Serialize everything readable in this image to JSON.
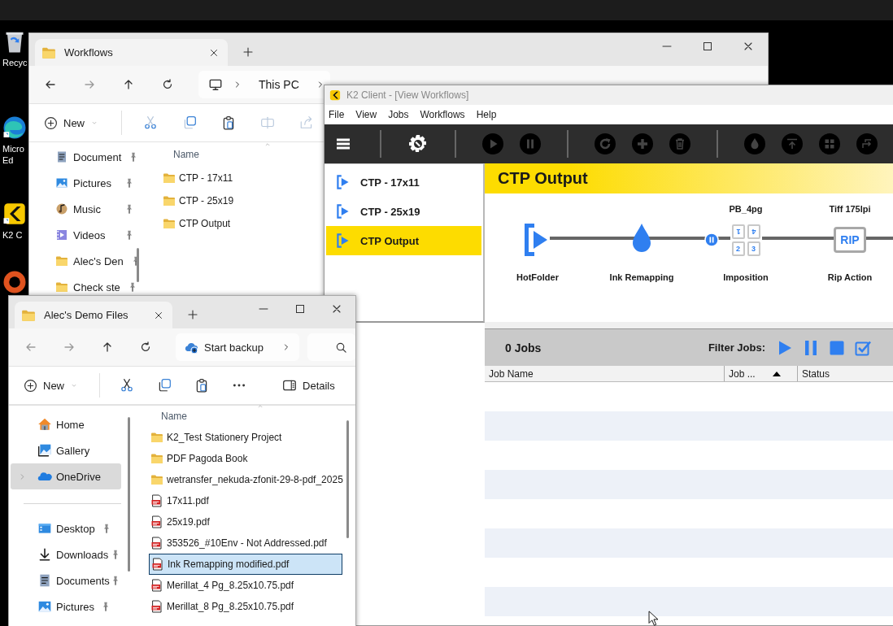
{
  "desktop": {
    "icons": [
      {
        "kind": "recycle",
        "label": "Recyc"
      },
      {
        "kind": "edge",
        "label": "Micro Ed"
      },
      {
        "kind": "k2",
        "label": "K2 C"
      },
      {
        "kind": "app"
      }
    ]
  },
  "workflows_window": {
    "tab_title": "Workflows",
    "breadcrumb": [
      "This PC"
    ],
    "new_label": "New",
    "sidebar": [
      {
        "kind": "documents",
        "label": "Document",
        "pinned": true
      },
      {
        "kind": "pictures",
        "label": "Pictures",
        "pinned": true
      },
      {
        "kind": "music",
        "label": "Music",
        "pinned": true
      },
      {
        "kind": "videos",
        "label": "Videos",
        "pinned": true
      },
      {
        "kind": "folder",
        "label": "Alec's Den",
        "pinned": true
      },
      {
        "kind": "folder",
        "label": "Check ste",
        "pinned": true
      }
    ],
    "list_header": "Name",
    "files": [
      {
        "kind": "folder",
        "name": "CTP - 17x11"
      },
      {
        "kind": "folder",
        "name": "CTP - 25x19"
      },
      {
        "kind": "folder",
        "name": "CTP Output"
      }
    ]
  },
  "k2_window": {
    "title": "K2 Client - [View Workflows]",
    "menu": [
      "File",
      "View",
      "Jobs",
      "Workflows",
      "Help"
    ],
    "workflows": [
      {
        "name": "CTP - 17x11",
        "selected": false
      },
      {
        "name": "CTP - 25x19",
        "selected": false
      },
      {
        "name": "CTP Output",
        "selected": true
      }
    ],
    "header": "CTP Output",
    "nodes": [
      {
        "kind": "hotfolder",
        "label": "HotFolder"
      },
      {
        "kind": "ink",
        "label": "Ink Remapping",
        "paused": true
      },
      {
        "kind": "imposition",
        "label": "Imposition",
        "caption": "PB_4pg",
        "pages": [
          "1",
          "4",
          "2",
          "3"
        ]
      },
      {
        "kind": "rip",
        "label": "Rip Action",
        "caption": "Tiff 175lpi",
        "badge": "RIP"
      }
    ],
    "jobs_count": "0 Jobs",
    "filter_label": "Filter Jobs:",
    "columns": [
      {
        "label": "Job Name",
        "sorted": false
      },
      {
        "label": "Job ...",
        "sorted": true
      },
      {
        "label": "Status",
        "sorted": false
      }
    ]
  },
  "alec_window": {
    "tab_title": "Alec's Demo Files",
    "backup_label": "Start backup",
    "new_label": "New",
    "details_label": "Details",
    "sidebar": [
      {
        "kind": "home",
        "label": "Home",
        "pinned": false,
        "selected": false
      },
      {
        "kind": "gallery",
        "label": "Gallery",
        "pinned": false,
        "selected": false
      },
      {
        "kind": "onedrive",
        "label": "OneDrive",
        "pinned": false,
        "selected": true
      }
    ],
    "quick_access": [
      {
        "kind": "desktop",
        "label": "Desktop",
        "pinned": true,
        "selected": false
      },
      {
        "kind": "downloads",
        "label": "Downloads",
        "pinned": true,
        "selected": false
      },
      {
        "kind": "documents",
        "label": "Documents",
        "pinned": true,
        "selected": false
      },
      {
        "kind": "pictures",
        "label": "Pictures",
        "pinned": true,
        "selected": false
      }
    ],
    "list_header": "Name",
    "files": [
      {
        "kind": "folder",
        "name": "K2_Test Stationery Project",
        "selected": false
      },
      {
        "kind": "folder",
        "name": "PDF Pagoda Book",
        "selected": false
      },
      {
        "kind": "folder",
        "name": "wetransfer_nekuda-zfonit-29-8-pdf_2025",
        "selected": false
      },
      {
        "kind": "pdf",
        "name": "17x11.pdf",
        "selected": false
      },
      {
        "kind": "pdf",
        "name": "25x19.pdf",
        "selected": false
      },
      {
        "kind": "pdf",
        "name": "353526_#10Env - Not Addressed.pdf",
        "selected": false
      },
      {
        "kind": "pdf",
        "name": "Ink Remapping modified.pdf",
        "selected": true
      },
      {
        "kind": "pdf",
        "name": "Merillat_4 Pg_8.25x10.75.pdf",
        "selected": false
      },
      {
        "kind": "pdf",
        "name": "Merillat_8 Pg_8.25x10.75.pdf",
        "selected": false
      }
    ]
  }
}
